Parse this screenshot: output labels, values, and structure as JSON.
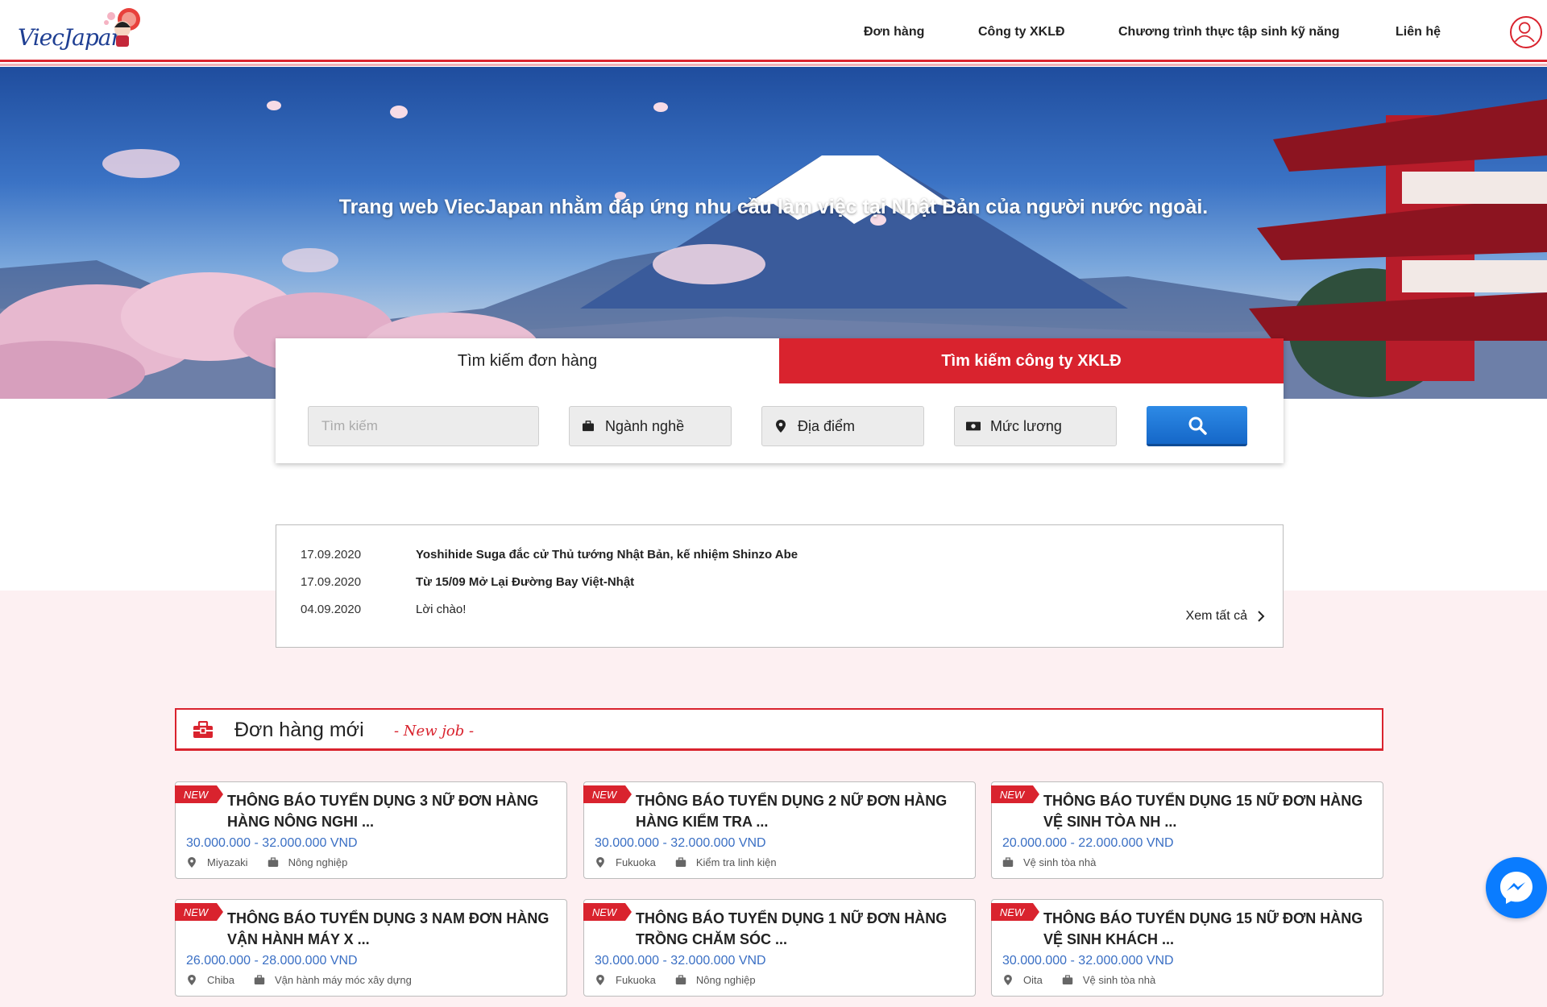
{
  "header": {
    "logo_text": "ViecJapan",
    "nav": [
      "Đơn hàng",
      "Công ty XKLĐ",
      "Chương trình thực tập sinh kỹ năng",
      "Liên hệ"
    ]
  },
  "hero": {
    "headline": "Trang web ViecJapan nhằm đáp ứng nhu cầu làm việc tại Nhật Bản của người nước ngoài."
  },
  "search": {
    "tabs": [
      "Tìm kiếm đơn hàng",
      "Tìm kiếm công ty XKLĐ"
    ],
    "active_tab": "Tìm kiếm công ty XKLĐ",
    "input_placeholder": "Tìm kiếm",
    "industry_label": "Ngành nghề",
    "location_label": "Địa điểm",
    "salary_label": "Mức lương"
  },
  "news": {
    "items": [
      {
        "date": "17.09.2020",
        "title": "Yoshihide Suga đắc cử Thủ tướng Nhật Bản, kế nhiệm Shinzo Abe"
      },
      {
        "date": "17.09.2020",
        "title": "Từ 15/09 Mở Lại Đường Bay Việt-Nhật"
      },
      {
        "date": "04.09.2020",
        "title": "Lời chào!"
      }
    ],
    "view_all": "Xem tất cả"
  },
  "section": {
    "title": "Đơn hàng mới",
    "subtitle": "- New job -"
  },
  "jobs": [
    {
      "badge": "NEW",
      "title": "THÔNG BÁO TUYỂN DỤNG 3 NỮ ĐƠN HÀNG HÀNG NÔNG NGHI ...",
      "salary": "30.000.000 - 32.000.000 VND",
      "location": "Miyazaki",
      "industry": "Nông nghiệp"
    },
    {
      "badge": "NEW",
      "title": "THÔNG BÁO TUYỂN DỤNG 2 NỮ ĐƠN HÀNG HÀNG KIỂM TRA ...",
      "salary": "30.000.000 - 32.000.000 VND",
      "location": "Fukuoka",
      "industry": "Kiểm tra linh kiện"
    },
    {
      "badge": "NEW",
      "title": "THÔNG BÁO TUYỂN DỤNG 15 NỮ ĐƠN HÀNG VỆ SINH TÒA NH ...",
      "salary": "20.000.000 - 22.000.000 VND",
      "location": "",
      "industry": "Vệ sinh tòa nhà"
    },
    {
      "badge": "NEW",
      "title": "THÔNG BÁO TUYỂN DỤNG 3 NAM ĐƠN HÀNG VẬN HÀNH MÁY X ...",
      "salary": "26.000.000 - 28.000.000 VND",
      "location": "Chiba",
      "industry": "Vận hành máy móc xây dựng"
    },
    {
      "badge": "NEW",
      "title": "THÔNG BÁO TUYỂN DỤNG 1 NỮ ĐƠN HÀNG TRỒNG CHĂM SÓC ...",
      "salary": "30.000.000 - 32.000.000 VND",
      "location": "Fukuoka",
      "industry": "Nông nghiệp"
    },
    {
      "badge": "NEW",
      "title": "THÔNG BÁO TUYỂN DỤNG 15 NỮ ĐƠN HÀNG VỆ SINH KHÁCH ...",
      "salary": "30.000.000 - 32.000.000 VND",
      "location": "Oita",
      "industry": "Vệ sinh tòa nhà"
    }
  ],
  "colors": {
    "brand_red": "#d9232e",
    "salary_blue": "#3a6fc4",
    "search_blue": "#1567c8",
    "messenger_blue": "#0a7cff"
  },
  "icons": [
    "user-icon",
    "briefcase-icon",
    "location-pin-icon",
    "money-icon",
    "search-icon",
    "chevron-right-icon",
    "messenger-icon"
  ]
}
